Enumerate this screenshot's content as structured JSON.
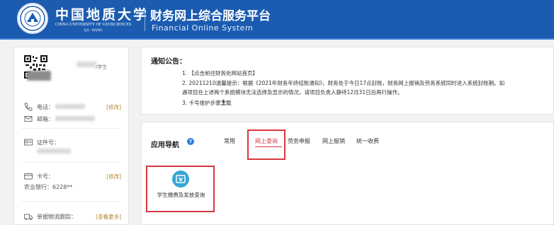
{
  "header": {
    "university_cn": "中国地质大学",
    "university_en": "CHINA UNIVERSITY OF GEOSCIENCES",
    "university_city": "北京 · BEIJING",
    "system_title": "财务网上综合服务平台",
    "system_subtitle": "Financial Online System",
    "brand_color": "#1b5cb0"
  },
  "profile": {
    "student_tag": "/学生",
    "phone_label": "电话：",
    "phone_edit": "[修改]",
    "email_label": "邮箱：",
    "id_label": "证件号：",
    "card_label": "卡号：",
    "card_edit": "[修改]",
    "bank_label": "农业银行：6228**",
    "logistics_label": "单据物流跟踪：",
    "logistics_more": "[查看更多]"
  },
  "notice": {
    "title": "通知公告：",
    "items": [
      "1. 【点击前往财务处网站首页】",
      "2. 20211210温馨提示：根据《2021年财务年终结账通知》，财务处于今日17点封账，财务网上报销及劳务系统同时进入系统封账期。如",
      "遇项目在上述两个系统模块无法选择及显示的情况，请项目负责人静待12月31日后再行操作。",
      "3. 卡号维护步骤下载"
    ]
  },
  "nav": {
    "title": "应用导航",
    "help": "?",
    "tabs": [
      "常用",
      "网上查询",
      "劳务申报",
      "网上报销",
      "统一收费"
    ],
    "active_tab": "网上查询",
    "active_color": "#d9363e",
    "app": {
      "label": "学生缴费及发放查询",
      "icon": "receipt-icon"
    }
  }
}
